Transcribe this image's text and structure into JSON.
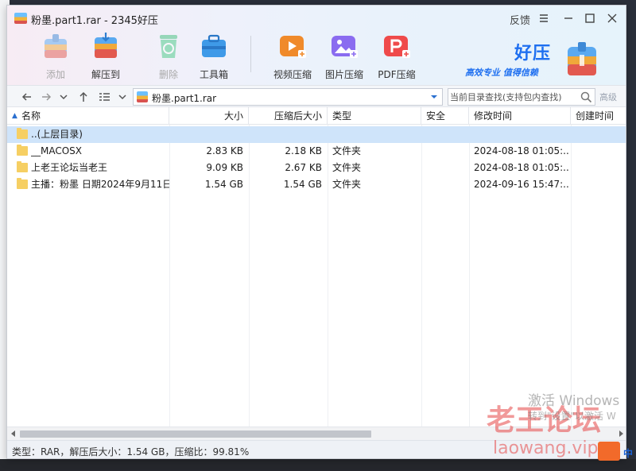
{
  "window": {
    "title": "粉墨.part1.rar - 2345好压",
    "feedback_label": "反馈"
  },
  "toolbar": {
    "items": [
      {
        "label": "添加",
        "icon": "add-archive-icon",
        "enabled": false
      },
      {
        "label": "解压到",
        "icon": "extract-icon",
        "enabled": true
      },
      {
        "label": "删除",
        "icon": "recycle-icon",
        "enabled": false
      },
      {
        "label": "工具箱",
        "icon": "toolbox-icon",
        "enabled": true
      },
      {
        "label": "视频压缩",
        "icon": "video-compress-icon",
        "enabled": true
      },
      {
        "label": "图片压缩",
        "icon": "image-compress-icon",
        "enabled": true
      },
      {
        "label": "PDF压缩",
        "icon": "pdf-compress-icon",
        "enabled": true
      }
    ]
  },
  "brand": {
    "name": "好压",
    "slogan": "高效专业  值得信赖",
    "color": "#1e6ff0"
  },
  "address": {
    "path": "粉墨.part1.rar",
    "search_placeholder": "当前目录查找(支持包内查找)",
    "advanced_label": "高级"
  },
  "columns": [
    "名称",
    "大小",
    "压缩后大小",
    "类型",
    "安全",
    "修改时间",
    "创建时间"
  ],
  "rows": [
    {
      "name": "..(上层目录)",
      "size": "",
      "packed": "",
      "type": "",
      "security": "",
      "modified": "",
      "created": "",
      "selected": true
    },
    {
      "name": "__MACOSX",
      "size": "2.83 KB",
      "packed": "2.18 KB",
      "type": "文件夹",
      "security": "",
      "modified": "2024-08-18 01:05:...",
      "created": "",
      "selected": false
    },
    {
      "name": "上老王论坛当老王",
      "size": "9.09 KB",
      "packed": "2.67 KB",
      "type": "文件夹",
      "security": "",
      "modified": "2024-08-18 01:05:...",
      "created": "",
      "selected": false
    },
    {
      "name": "主播：粉墨 日期2024年9月11日",
      "size": "1.54 GB",
      "packed": "1.54 GB",
      "type": "文件夹",
      "security": "",
      "modified": "2024-09-16 15:47:...",
      "created": "",
      "selected": false
    }
  ],
  "status": {
    "text": "类型：RAR，解压后大小：1.54 GB，压缩比：99.81%"
  },
  "watermarks": {
    "activate_title": "激活 Windows",
    "activate_sub": "转到\"设置\"以激活 W",
    "site": "老王论坛",
    "url": "laowang.vip",
    "lang": "中"
  },
  "colors": {
    "selected_row": "#cfe4fa",
    "folder": "#f6cf63"
  }
}
